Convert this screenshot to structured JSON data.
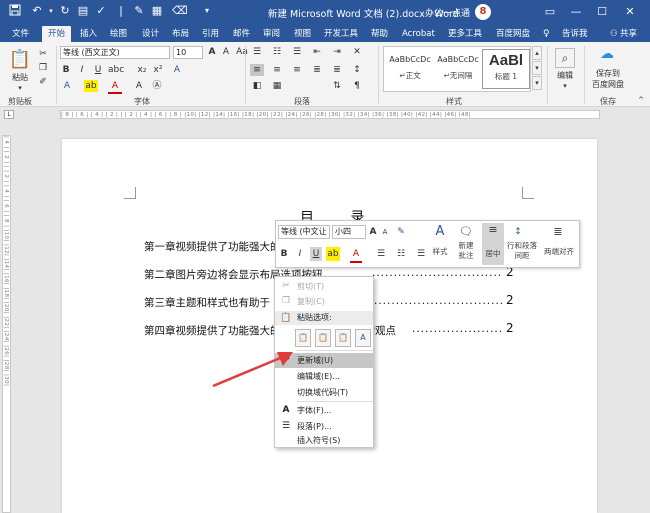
{
  "titlebar": {
    "title": "新建 Microsoft Word 文档 (2).docx - Word",
    "user": "办公一点通",
    "avatar_text": "8",
    "qa_icons": [
      "save-icon",
      "undo-icon",
      "redo-icon",
      "print-preview-icon",
      "spell-check-icon",
      "track-changes-icon",
      "format-painter-icon"
    ]
  },
  "tabs": [
    "文件",
    "开始",
    "插入",
    "绘图",
    "设计",
    "布局",
    "引用",
    "邮件",
    "审阅",
    "视图",
    "开发工具",
    "帮助",
    "Acrobat",
    "更多工具",
    "百度网盘",
    "告诉我",
    "共享"
  ],
  "active_tab": "开始",
  "ribbon": {
    "clipboard": {
      "paste": "粘贴",
      "label": "剪贴板"
    },
    "font": {
      "font_name": "等线 (西文正文)",
      "font_size": "10",
      "label": "字体"
    },
    "paragraph": {
      "label": "段落"
    },
    "styles": {
      "label": "样式",
      "items": [
        {
          "preview": "AaBbCcDc",
          "name": "↵正文"
        },
        {
          "preview": "AaBbCcDc",
          "name": "↵无间隔"
        },
        {
          "preview": "AaBl",
          "name": "标题 1"
        }
      ]
    },
    "editing": {
      "label": "编辑"
    },
    "save": {
      "line1": "保存到",
      "line2": "百度网盘",
      "group_label": "保存"
    }
  },
  "ruler": {
    "h_ticks": "| 8 |    | 6 |    | 4 |    | 2 |    |    | 2 |    | 4 |    | 6 |    | 8 |    |10|    |12|    |14|    |16|    |18|    |20|    |22|    |24|    |26|    |28|    |30|    |32|    |34|    |36|    |38|    |40|    |42|    |44|    |46|    |48|",
    "v_ticks": "| 4 |    | 2 |    |    | 2 |    | 4 |    | 6 |    | 8 |    |10|    |12|    |14|    |16|    |18|    |20|    |22|    |24|    |26|    |28|    |30|"
  },
  "document": {
    "toc_title": "目 录",
    "entries": [
      {
        "text": "第一章视频提供了功能强大的",
        "page": ""
      },
      {
        "text": "第二章图片旁边将会显示布局选项按钮",
        "page": "2"
      },
      {
        "text": "第三章主题和样式也有助于",
        "page": "2"
      },
      {
        "text": "第四章视频提供了功能强大的方法帮助您证明您的观点",
        "page": "2"
      }
    ]
  },
  "minibar": {
    "font_name": "等线 (中文让",
    "font_size": "小四",
    "styles_label": "样式",
    "new_comment_l1": "新建",
    "new_comment_l2": "批注",
    "center_label": "居中",
    "line_spacing_l1": "行和段落",
    "line_spacing_l2": "间距",
    "justify_label": "两端对齐"
  },
  "context_menu": {
    "cut": "剪切(T)",
    "copy": "复制(C)",
    "paste_options": "粘贴选项:",
    "update_field": "更新域(U)",
    "edit_field": "编辑域(E)...",
    "toggle_field_codes": "切换域代码(T)",
    "font": "字体(F)...",
    "paragraph": "段落(P)...",
    "insert_symbol": "插入符号(S)"
  },
  "colors": {
    "title_blue": "#2b579a",
    "arrow_red": "#e23b3b",
    "highlight_gray": "#c6c6c6"
  }
}
